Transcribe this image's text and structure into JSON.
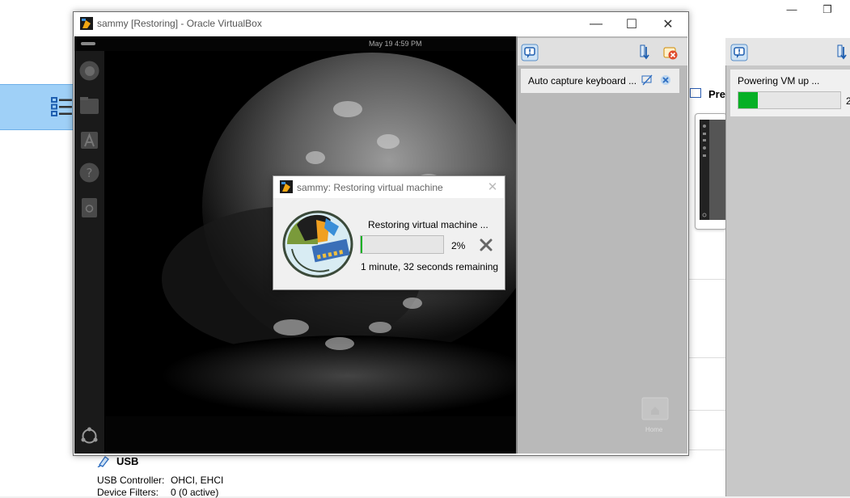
{
  "manager": {
    "usb": {
      "title": "USB",
      "controller_label": "USB Controller:",
      "controller_value": "OHCI, EHCI",
      "filters_label": "Device Filters:",
      "filters_value": "0 (0 active)"
    },
    "preview_label": "Pre",
    "window_buttons": {
      "minimize": "—",
      "restore": "❐"
    },
    "notification": {
      "text": "Powering VM up ...",
      "progress": 0.02,
      "percent": "2"
    }
  },
  "vm_window": {
    "title": "sammy [Restoring] - Oracle VirtualBox",
    "buttons": {
      "minimize": "—",
      "maximize": "☐",
      "close": "✕"
    },
    "guest": {
      "topbar_datetime": "May 19   4:59 PM",
      "home_label": "Home"
    },
    "overlay": {
      "message": "Auto capture keyboard ..."
    }
  },
  "dialog": {
    "title": "sammy: Restoring virtual machine",
    "label": "Restoring virtual machine ...",
    "progress": 0.02,
    "percent": "2%",
    "remaining": "1 minute, 32 seconds remaining"
  },
  "colors": {
    "progress_fill": "#06b025",
    "selection": "#9fd0f7"
  },
  "icons": [
    "tools-list-icon",
    "virtualbox-app-icon",
    "restore-vm-icon",
    "cancel-icon",
    "info-bubble-icon",
    "usb-icon",
    "home-folder-icon"
  ]
}
